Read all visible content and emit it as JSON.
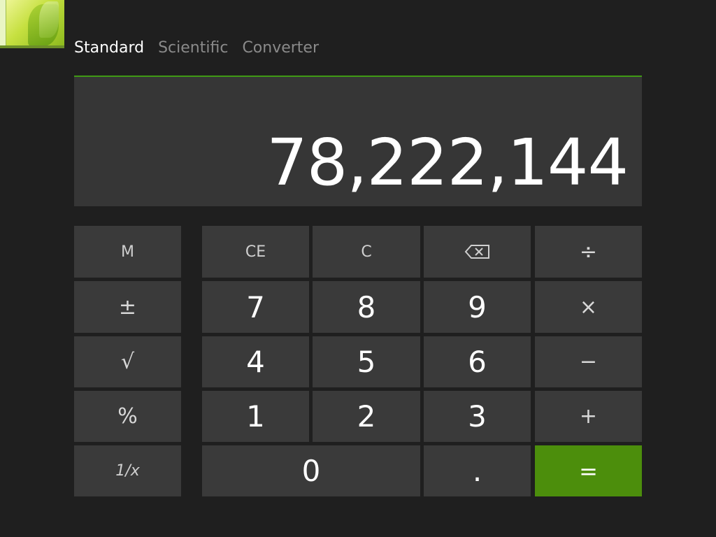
{
  "tabs": [
    {
      "label": "Standard",
      "active": true
    },
    {
      "label": "Scientific",
      "active": false
    },
    {
      "label": "Converter",
      "active": false
    }
  ],
  "display": {
    "value": "78,222,144"
  },
  "keys": {
    "memory": "M",
    "ce": "CE",
    "clear": "C",
    "backspace_icon": "backspace-icon",
    "divide": "÷",
    "plus_minus": "±",
    "seven": "7",
    "eight": "8",
    "nine": "9",
    "multiply": "×",
    "sqrt": "√",
    "four": "4",
    "five": "5",
    "six": "6",
    "subtract": "−",
    "percent": "%",
    "one": "1",
    "two": "2",
    "three": "3",
    "add": "+",
    "reciprocal": "1/x",
    "zero": "0",
    "decimal": ".",
    "equals": "="
  },
  "colors": {
    "accent": "#4c8e0c",
    "accent_line": "#3f9a14",
    "background": "#1f1f1f",
    "key": "#3a3a3a",
    "display": "#363636"
  }
}
